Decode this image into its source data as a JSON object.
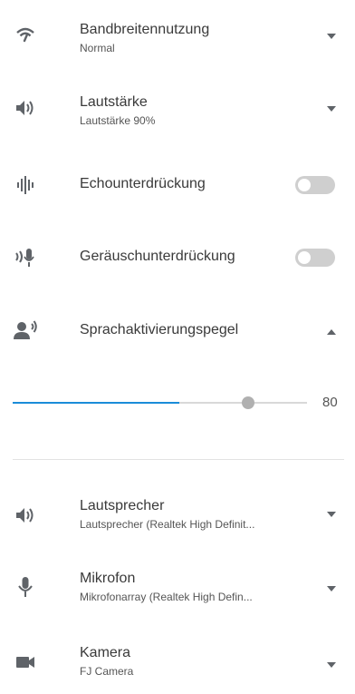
{
  "settings": {
    "bandwidth": {
      "title": "Bandbreitennutzung",
      "value": "Normal",
      "icon": "wifi-icon"
    },
    "volume": {
      "title": "Lautstärke",
      "value": "Lautstärke 90%",
      "icon": "speaker-icon"
    },
    "echo": {
      "title": "Echounterdrückung",
      "enabled": false,
      "icon": "waveform-icon"
    },
    "noise": {
      "title": "Geräuschunterdrückung",
      "enabled": false,
      "icon": "mic-waves-icon"
    },
    "voice": {
      "title": "Sprachaktivierungspegel",
      "icon": "person-speaking-icon",
      "expanded": true,
      "slider_value": "80",
      "slider_fraction": 0.8
    }
  },
  "devices": {
    "speaker": {
      "title": "Lautsprecher",
      "value": "Lautsprecher (Realtek High Definit...",
      "icon": "speaker-icon"
    },
    "microphone": {
      "title": "Mikrofon",
      "value": "Mikrofonarray (Realtek High Defin...",
      "icon": "microphone-icon"
    },
    "camera": {
      "title": "Kamera",
      "value": "FJ Camera",
      "icon": "camera-icon"
    }
  },
  "colors": {
    "accent": "#1a8cd8",
    "icon": "#5f6368",
    "toggle_off": "#cfcfcf"
  }
}
